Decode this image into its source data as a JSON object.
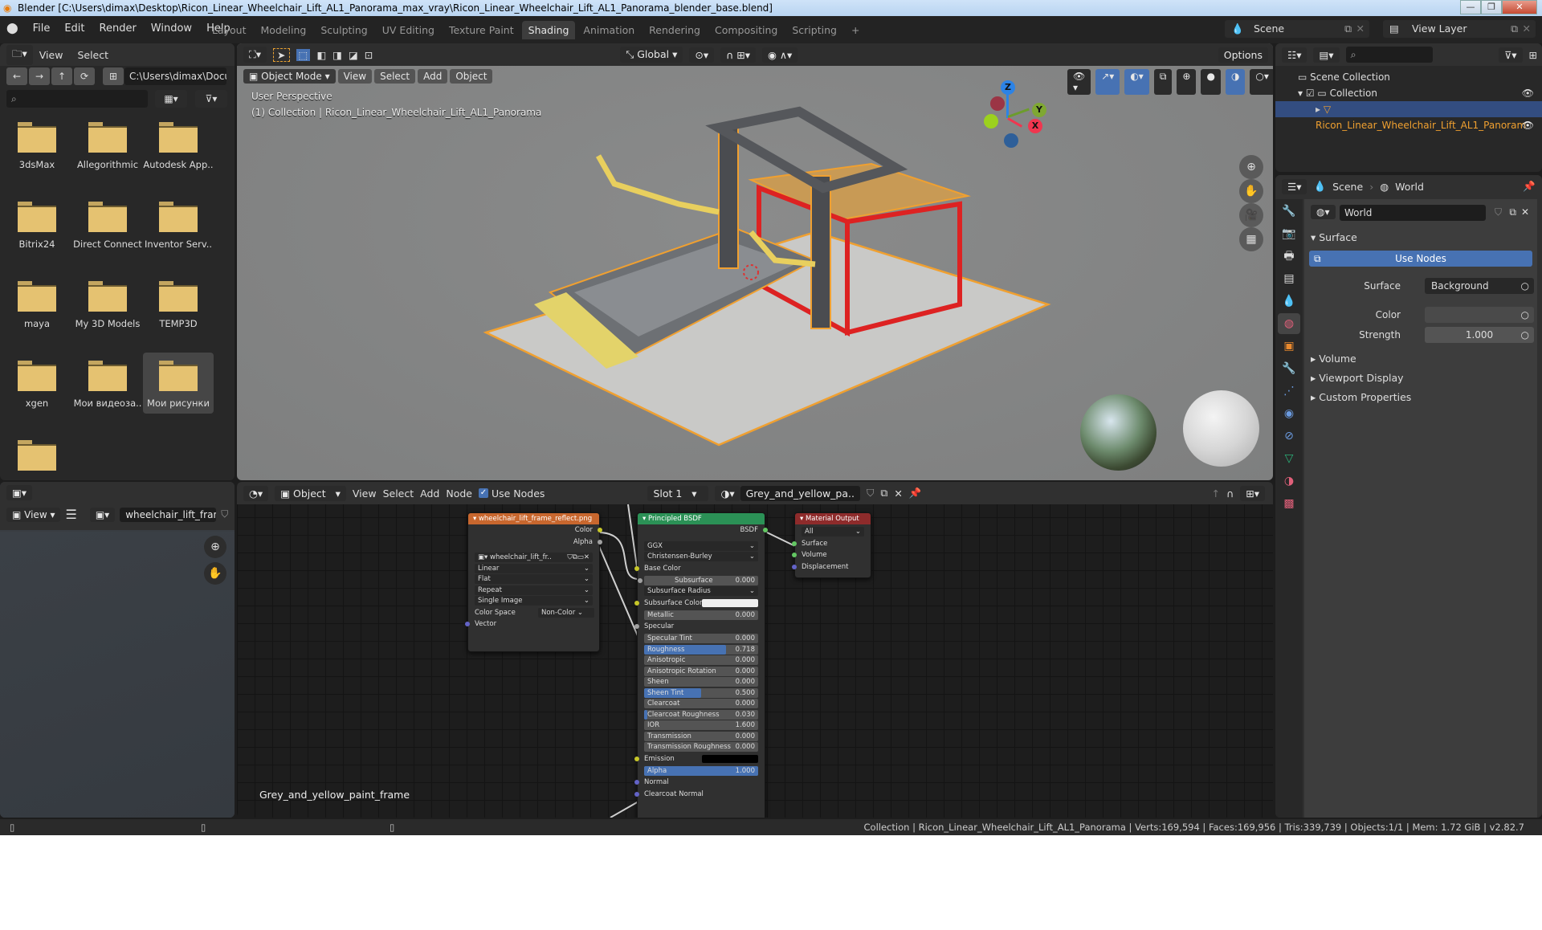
{
  "window": {
    "title": "Blender [C:\\Users\\dimax\\Desktop\\Ricon_Linear_Wheelchair_Lift_AL1_Panorama_max_vray\\Ricon_Linear_Wheelchair_Lift_AL1_Panorama_blender_base.blend]",
    "minimize": "—",
    "maximize": "❐",
    "close": "✕"
  },
  "menu": [
    "File",
    "Edit",
    "Render",
    "Window",
    "Help"
  ],
  "workspaces": [
    {
      "label": "Layout",
      "active": false
    },
    {
      "label": "Modeling",
      "active": false
    },
    {
      "label": "Sculpting",
      "active": false
    },
    {
      "label": "UV Editing",
      "active": false
    },
    {
      "label": "Texture Paint",
      "active": false
    },
    {
      "label": "Shading",
      "active": true
    },
    {
      "label": "Animation",
      "active": false
    },
    {
      "label": "Rendering",
      "active": false
    },
    {
      "label": "Compositing",
      "active": false
    },
    {
      "label": "Scripting",
      "active": false
    }
  ],
  "add_workspace": "+",
  "scene_selector": "Scene",
  "view_layer_selector": "View Layer",
  "file_browser": {
    "menu": [
      "View",
      "Select"
    ],
    "path": "C:\\Users\\dimax\\Docu..",
    "search_placeholder": "",
    "nav_icons": [
      "←",
      "→",
      "↑",
      "⟳"
    ],
    "folders": [
      {
        "name": "3dsMax",
        "selected": false
      },
      {
        "name": "Allegorithmic",
        "selected": false
      },
      {
        "name": "Autodesk App..",
        "selected": false
      },
      {
        "name": "Bitrix24",
        "selected": false
      },
      {
        "name": "Direct Connect",
        "selected": false
      },
      {
        "name": "Inventor Serv..",
        "selected": false
      },
      {
        "name": "maya",
        "selected": false
      },
      {
        "name": "My 3D Models",
        "selected": false
      },
      {
        "name": "TEMP3D",
        "selected": false
      },
      {
        "name": "xgen",
        "selected": false
      },
      {
        "name": "Мои видеоза..",
        "selected": false
      },
      {
        "name": "Мои рисунки",
        "selected": true
      },
      {
        "name": "",
        "selected": false
      }
    ]
  },
  "image_editor": {
    "view_label": "View",
    "image_name": "wheelchair_lift_fram.."
  },
  "viewport": {
    "mode": "Object Mode",
    "menu": [
      "View",
      "Select",
      "Add",
      "Object"
    ],
    "orientation": "Global",
    "options_label": "Options",
    "info_line1": "User Perspective",
    "info_line2": "(1) Collection | Ricon_Linear_Wheelchair_Lift_AL1_Panorama",
    "gizmo": {
      "z": "Z",
      "y": "Y",
      "x": "X"
    },
    "axis_colors": {
      "x": "#f0364f",
      "y": "#6c9c2c",
      "z": "#2c83e6"
    },
    "selection_outline_color": "#f0a030"
  },
  "node_editor": {
    "object_mode": "Object",
    "menu": [
      "View",
      "Select",
      "Add",
      "Node"
    ],
    "use_nodes_label": "Use Nodes",
    "use_nodes_checked": true,
    "slot": "Slot 1",
    "material_name": "Grey_and_yellow_pa..",
    "material_label": "Grey_and_yellow_paint_frame",
    "image_node": {
      "title": "wheelchair_lift_frame_reflect.png",
      "outputs": [
        "Color",
        "Alpha"
      ],
      "image": "wheelchair_lift_fr..",
      "interpolation": "Linear",
      "projection": "Flat",
      "extension": "Repeat",
      "source": "Single Image",
      "color_space_label": "Color Space",
      "color_space": "Non-Color",
      "input": "Vector"
    },
    "bsdf_node": {
      "title": "Principled BSDF",
      "output": "BSDF",
      "distribution": "GGX",
      "subsurface_method": "Christensen-Burley",
      "base_color_label": "Base Color",
      "subsurface": {
        "label": "Subsurface",
        "value": "0.000",
        "fraction": 0.0
      },
      "subsurface_radius": "Subsurface Radius",
      "subsurface_color": "Subsurface Color",
      "metallic": {
        "label": "Metallic",
        "value": "0.000",
        "fraction": 0.0
      },
      "specular_label": "Specular",
      "specular_tint": {
        "label": "Specular Tint",
        "value": "0.000",
        "fraction": 0.0
      },
      "roughness": {
        "label": "Roughness",
        "value": "0.718",
        "fraction": 0.718
      },
      "anisotropic": {
        "label": "Anisotropic",
        "value": "0.000",
        "fraction": 0.0
      },
      "anisotropic_rotation": {
        "label": "Anisotropic Rotation",
        "value": "0.000",
        "fraction": 0.0
      },
      "sheen": {
        "label": "Sheen",
        "value": "0.000",
        "fraction": 0.0
      },
      "sheen_tint": {
        "label": "Sheen Tint",
        "value": "0.500",
        "fraction": 0.5
      },
      "clearcoat": {
        "label": "Clearcoat",
        "value": "0.000",
        "fraction": 0.0
      },
      "clearcoat_roughness": {
        "label": "Clearcoat Roughness",
        "value": "0.030",
        "fraction": 0.03
      },
      "ior": {
        "label": "IOR",
        "value": "1.600"
      },
      "transmission": {
        "label": "Transmission",
        "value": "0.000",
        "fraction": 0.0
      },
      "transmission_roughness": {
        "label": "Transmission Roughness",
        "value": "0.000",
        "fraction": 0.0
      },
      "emission_label": "Emission",
      "alpha": {
        "label": "Alpha",
        "value": "1.000",
        "fraction": 1.0
      },
      "normal_label": "Normal",
      "clearcoat_normal_label": "Clearcoat Normal"
    },
    "output_node": {
      "title": "Material Output",
      "target": "All",
      "inputs": [
        "Surface",
        "Volume",
        "Displacement"
      ]
    }
  },
  "outliner": {
    "search_placeholder": "",
    "scene_collection": "Scene Collection",
    "collection": "Collection",
    "object": "Ricon_Linear_Wheelchair_Lift_AL1_Panoram"
  },
  "properties": {
    "breadcrumb_scene": "Scene",
    "breadcrumb_world": "World",
    "world_name": "World",
    "surface_panel": "Surface",
    "use_nodes_button": "Use Nodes",
    "surface_label": "Surface",
    "surface_value": "Background",
    "color_label": "Color",
    "strength_label": "Strength",
    "strength_value": "1.000",
    "collapsed_panels": [
      "Volume",
      "Viewport Display",
      "Custom Properties"
    ]
  },
  "status_bar": {
    "stats": "Collection | Ricon_Linear_Wheelchair_Lift_AL1_Panorama | Verts:169,594 | Faces:169,956 | Tris:339,739 | Objects:1/1 | Mem: 1.72 GiB | v2.82.7"
  }
}
